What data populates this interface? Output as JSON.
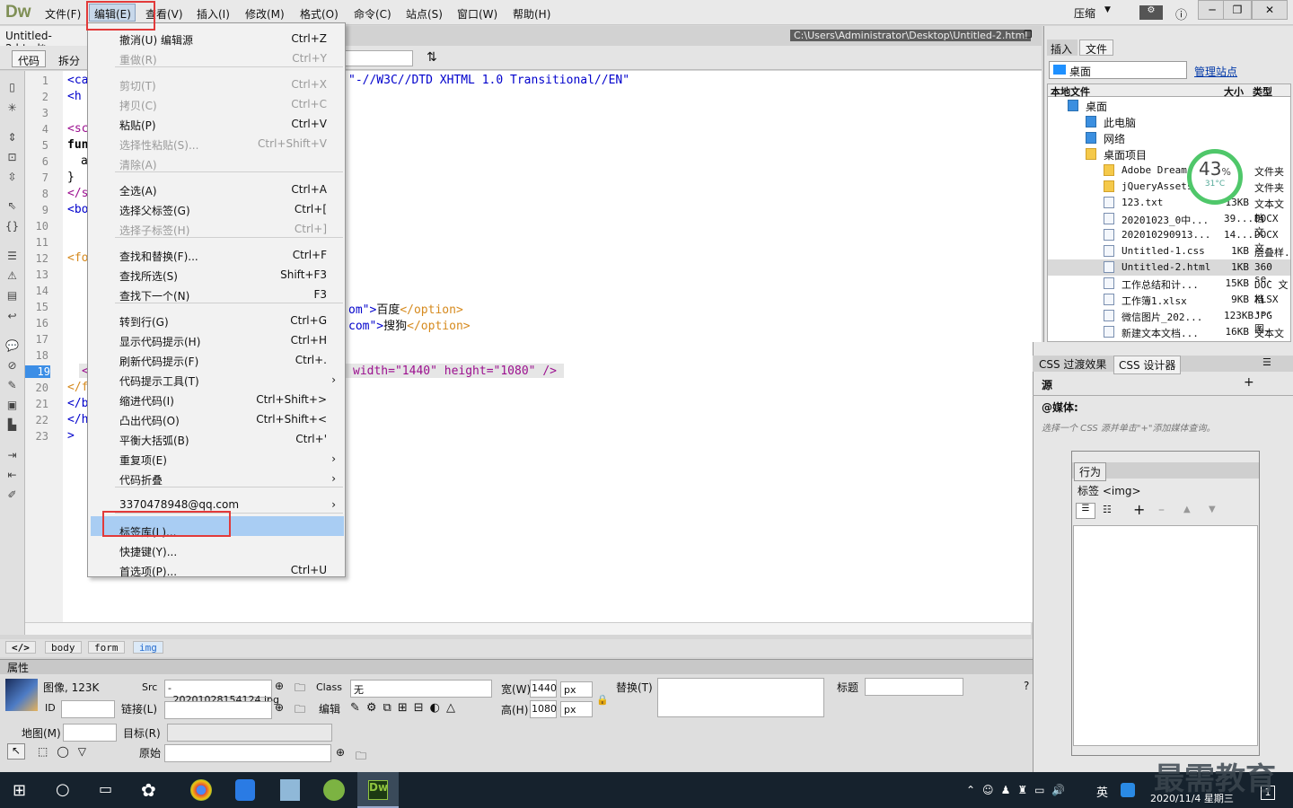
{
  "app": {
    "logo": "Dw"
  },
  "menubar": {
    "items": [
      "文件(F)",
      "编辑(E)",
      "查看(V)",
      "插入(I)",
      "修改(M)",
      "格式(O)",
      "命令(C)",
      "站点(S)",
      "窗口(W)",
      "帮助(H)"
    ],
    "compress": "压缩"
  },
  "doc": {
    "tab": "Untitled-2.html*",
    "path": "C:\\Users\\Administrator\\Desktop\\Untitled-2.html"
  },
  "toolbar": {
    "code": "代码",
    "split": "拆分"
  },
  "code": {
    "line_numbers": [
      "1",
      "2",
      "3",
      "4",
      "5",
      "6",
      "7",
      "8",
      "9",
      "10",
      "11",
      "12",
      "13",
      "14",
      "15",
      "16",
      "17",
      "18",
      "19",
      "20",
      "21",
      "22",
      "23"
    ],
    "current_line": "19",
    "left": {
      "l1": "<ca",
      "l2": "<h",
      "l4": "<sc",
      "l5": "fun",
      "l6": "a",
      "l7": "}",
      "l8": "</s",
      "l9": "<bo",
      "l12": "<fo",
      "l19": "<",
      "l20": "</f",
      "l21": "</b",
      "l22": "</h",
      "l23": ">"
    },
    "l1_rest": "\"-//W3C//DTD XHTML 1.0 Transitional//EN\"",
    "l15a": "om\">",
    "l15b": "百度",
    "l15c": "</option>",
    "l16a": "com\">",
    "l16b": "搜狗",
    "l16c": "</option>",
    "l19_rest": "width=\"1440\" height=\"1080\" />"
  },
  "edit_menu": {
    "items": [
      {
        "label": "撤消(U) 编辑源",
        "shortcut": "Ctrl+Z",
        "disabled": false
      },
      {
        "label": "重做(R)",
        "shortcut": "Ctrl+Y",
        "disabled": true
      },
      {
        "label": "剪切(T)",
        "shortcut": "Ctrl+X",
        "disabled": true
      },
      {
        "label": "拷贝(C)",
        "shortcut": "Ctrl+C",
        "disabled": true
      },
      {
        "label": "粘贴(P)",
        "shortcut": "Ctrl+V",
        "disabled": false
      },
      {
        "label": "选择性粘贴(S)...",
        "shortcut": "Ctrl+Shift+V",
        "disabled": true
      },
      {
        "label": "清除(A)",
        "shortcut": "",
        "disabled": true
      },
      {
        "label": "全选(A)",
        "shortcut": "Ctrl+A",
        "disabled": false
      },
      {
        "label": "选择父标签(G)",
        "shortcut": "Ctrl+[",
        "disabled": false
      },
      {
        "label": "选择子标签(H)",
        "shortcut": "Ctrl+]",
        "disabled": true
      },
      {
        "label": "查找和替换(F)...",
        "shortcut": "Ctrl+F",
        "disabled": false
      },
      {
        "label": "查找所选(S)",
        "shortcut": "Shift+F3",
        "disabled": false
      },
      {
        "label": "查找下一个(N)",
        "shortcut": "F3",
        "disabled": false
      },
      {
        "label": "转到行(G)",
        "shortcut": "Ctrl+G",
        "disabled": false
      },
      {
        "label": "显示代码提示(H)",
        "shortcut": "Ctrl+H",
        "disabled": false
      },
      {
        "label": "刷新代码提示(F)",
        "shortcut": "Ctrl+.",
        "disabled": false
      },
      {
        "label": "代码提示工具(T)",
        "shortcut": "",
        "disabled": false
      },
      {
        "label": "缩进代码(I)",
        "shortcut": "Ctrl+Shift+>",
        "disabled": false
      },
      {
        "label": "凸出代码(O)",
        "shortcut": "Ctrl+Shift+<",
        "disabled": false
      },
      {
        "label": "平衡大括弧(B)",
        "shortcut": "Ctrl+'",
        "disabled": false
      },
      {
        "label": "重复项(E)",
        "shortcut": "",
        "disabled": false
      },
      {
        "label": "代码折叠",
        "shortcut": "",
        "disabled": false
      },
      {
        "label": "3370478948@qq.com",
        "shortcut": "",
        "disabled": false
      },
      {
        "label": "标签库(L)...",
        "shortcut": "",
        "disabled": false
      },
      {
        "label": "快捷键(Y)...",
        "shortcut": "",
        "disabled": false
      },
      {
        "label": "首选项(P)...",
        "shortcut": "Ctrl+U",
        "disabled": false
      }
    ]
  },
  "files_panel": {
    "tabs": [
      "插入",
      "文件"
    ],
    "location": "桌面",
    "manage": "管理站点",
    "headers": {
      "name": "本地文件",
      "size": "大小",
      "type": "类型"
    },
    "tree": [
      {
        "name": "桌面",
        "size": "",
        "type": ""
      },
      {
        "name": "此电脑",
        "size": "",
        "type": ""
      },
      {
        "name": "网络",
        "size": "",
        "type": ""
      },
      {
        "name": "桌面项目",
        "size": "",
        "type": ""
      },
      {
        "name": "Adobe Dream",
        "size": "",
        "type": "文件夹"
      },
      {
        "name": "jQueryAssets",
        "size": "",
        "type": "文件夹"
      },
      {
        "name": "123.txt",
        "size": "13KB",
        "type": "文本文档"
      },
      {
        "name": "20201023_0中...",
        "size": "39...",
        "type": "DOCX 文"
      },
      {
        "name": "202010290913...",
        "size": "14...",
        "type": "DOCX 文"
      },
      {
        "name": "Untitled-1.css",
        "size": "1KB",
        "type": "层叠样."
      },
      {
        "name": "Untitled-2.html",
        "size": "1KB",
        "type": "360 se."
      },
      {
        "name": "工作总结和计...",
        "size": "15KB",
        "type": "DOC 文档"
      },
      {
        "name": "工作簿1.xlsx",
        "size": "9KB",
        "type": "XLSX ..."
      },
      {
        "name": "微信图片_202...",
        "size": "123KB",
        "type": "JPG 图."
      },
      {
        "name": "新建文本文档...",
        "size": "16KB",
        "type": "文本文档"
      }
    ],
    "gauge": {
      "percent": "43",
      "unit": "%",
      "temp": "31°C"
    }
  },
  "css_panel": {
    "tabs": [
      "CSS 过渡效果",
      "CSS 设计器"
    ],
    "source": "源",
    "media": "@媒体:",
    "hint": "选择一个 CSS 源并单击\"+\"添加媒体查询。"
  },
  "behaviors": {
    "title": "行为",
    "tag": "标签 <img>"
  },
  "tags": [
    "body",
    "form",
    "img"
  ],
  "properties": {
    "header": "属性",
    "type": "图像, 123K",
    "src_label": "Src",
    "src": "-_20201028154124.jpg",
    "class_label": "Class",
    "class_value": "无",
    "width_label": "宽(W)",
    "width": "1440",
    "unit": "px",
    "height_label": "高(H)",
    "height": "1080",
    "alt_label": "替换(T)",
    "title_label": "标题",
    "id_label": "ID",
    "link_label": "链接(L)",
    "edit_label": "编辑",
    "map_label": "地图(M)",
    "target_label": "目标(R)",
    "orig_label": "原始"
  },
  "taskbar": {
    "ime": "英",
    "time": "2020/11/4 星期三",
    "notif": "1"
  },
  "watermark": "最需教育"
}
